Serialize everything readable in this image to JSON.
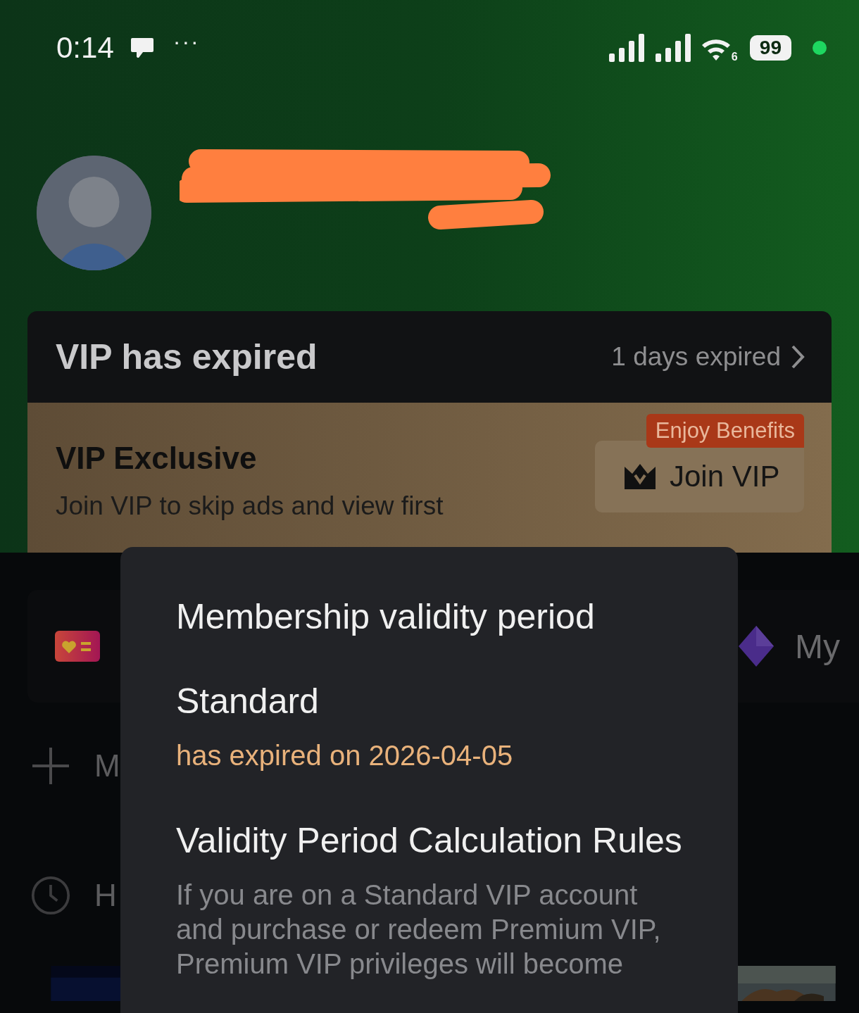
{
  "status_bar": {
    "time": "0:14",
    "more": "···",
    "wifi_badge": "6",
    "battery": "99"
  },
  "vip_card": {
    "title": "VIP has expired",
    "expiry": "1 days expired",
    "promo_title": "VIP Exclusive",
    "promo_text": "Join VIP to skip ads and view first",
    "badge": "Enjoy Benefits",
    "join_button": "Join VIP"
  },
  "shortcuts": [
    {
      "kind": "card"
    },
    {
      "kind": "gem",
      "label": "My"
    }
  ],
  "menu": [
    {
      "kind": "add",
      "label": "M"
    },
    {
      "kind": "history",
      "label": "H"
    }
  ],
  "dialog": {
    "title": "Membership validity period",
    "plan": "Standard",
    "status": "has expired on 2026-04-05",
    "rules_title": "Validity Period Calculation Rules",
    "rules_text": "If you are on a Standard VIP account and purchase or redeem Premium VIP, Premium VIP privileges will become"
  }
}
